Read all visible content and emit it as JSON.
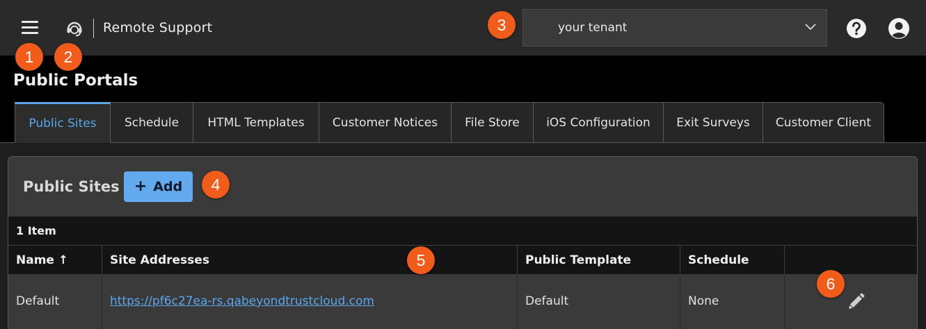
{
  "header": {
    "app_title": "Remote Support",
    "tenant_value": "your tenant"
  },
  "page": {
    "title": "Public Portals"
  },
  "tabs": [
    {
      "label": "Public Sites",
      "active": true
    },
    {
      "label": "Schedule"
    },
    {
      "label": "HTML Templates"
    },
    {
      "label": "Customer Notices"
    },
    {
      "label": "File Store"
    },
    {
      "label": "iOS Configuration"
    },
    {
      "label": "Exit Surveys"
    },
    {
      "label": "Customer Client"
    }
  ],
  "panel": {
    "title": "Public Sites",
    "add_label": "Add",
    "count_label": "1 Item"
  },
  "table": {
    "columns": [
      "Name ↑",
      "Site Addresses",
      "Public Template",
      "Schedule",
      ""
    ],
    "rows": [
      {
        "name": "Default",
        "site_address": "https://pf6c27ea-rs.qabeyondtrustcloud.com",
        "public_template": "Default",
        "schedule": "None"
      }
    ]
  },
  "badges": [
    "1",
    "2",
    "3",
    "4",
    "5",
    "6"
  ],
  "icons": [
    "hamburger-menu-icon",
    "headset-icon",
    "chevron-down-icon",
    "help-icon",
    "user-account-icon",
    "plus-icon",
    "pencil-edit-icon"
  ],
  "colors": {
    "accent": "#5aa7ec",
    "add_button": "#63a9ee",
    "badge": "#f25c1b",
    "topbar": "#2a2a2a"
  }
}
